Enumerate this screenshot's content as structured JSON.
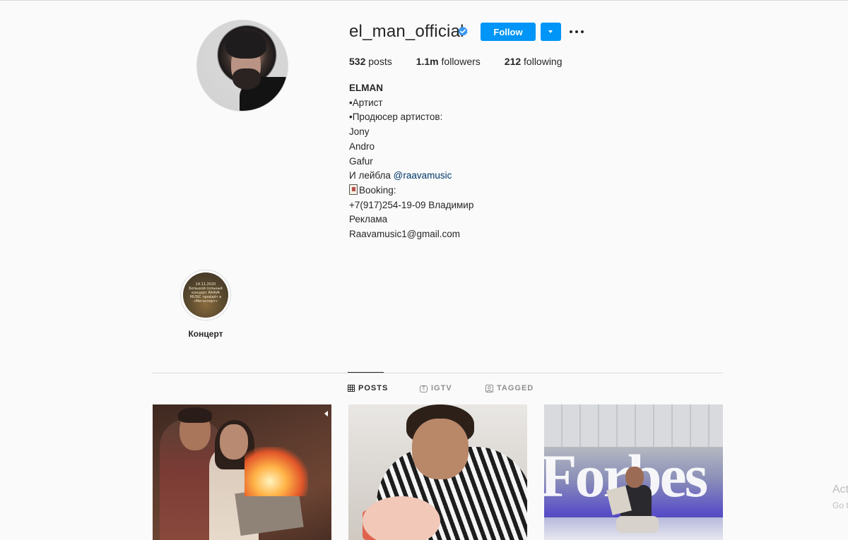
{
  "profile": {
    "username": "el_man_official",
    "follow_label": "Follow",
    "stats": {
      "posts_count": "532",
      "posts_label": " posts",
      "followers_count": "1.1m",
      "followers_label": " followers",
      "following_count": "212",
      "following_label": " following"
    },
    "bio": {
      "name": "ELMAN",
      "lines": [
        "•Артист",
        "•Продюсер артистов:",
        "Jony",
        "Andro",
        "Gafur"
      ],
      "label_line_prefix": "И лейбла ",
      "label_link": "@raavamusic",
      "booking": "Booking:",
      "phone": "+7(917)254-19-09 Владимир",
      "ads": "Реклама",
      "email": "Raavamusic1@gmail.com"
    }
  },
  "highlights": [
    {
      "label": "Концерт",
      "cover_text": "14.11.2020 Большой сольный концерт RAAVA MUSIC пройдёт в «Мегаспорт»"
    }
  ],
  "tabs": [
    {
      "label": "POSTS",
      "icon": "grid-icon",
      "active": true
    },
    {
      "label": "IGTV",
      "icon": "igtv-icon",
      "active": false
    },
    {
      "label": "TAGGED",
      "icon": "tagged-icon",
      "active": false
    }
  ],
  "posts": [
    {
      "type": "video",
      "icon": "video-camera-icon"
    },
    {
      "type": "image"
    },
    {
      "type": "image",
      "sign_text": "Forbes"
    }
  ],
  "overlay": {
    "line1": "Act",
    "line2": "Go t"
  },
  "colors": {
    "accent": "#0095f6",
    "link": "#00376b",
    "text": "#262626",
    "muted": "#8e8e8e",
    "background": "#fafafa"
  }
}
